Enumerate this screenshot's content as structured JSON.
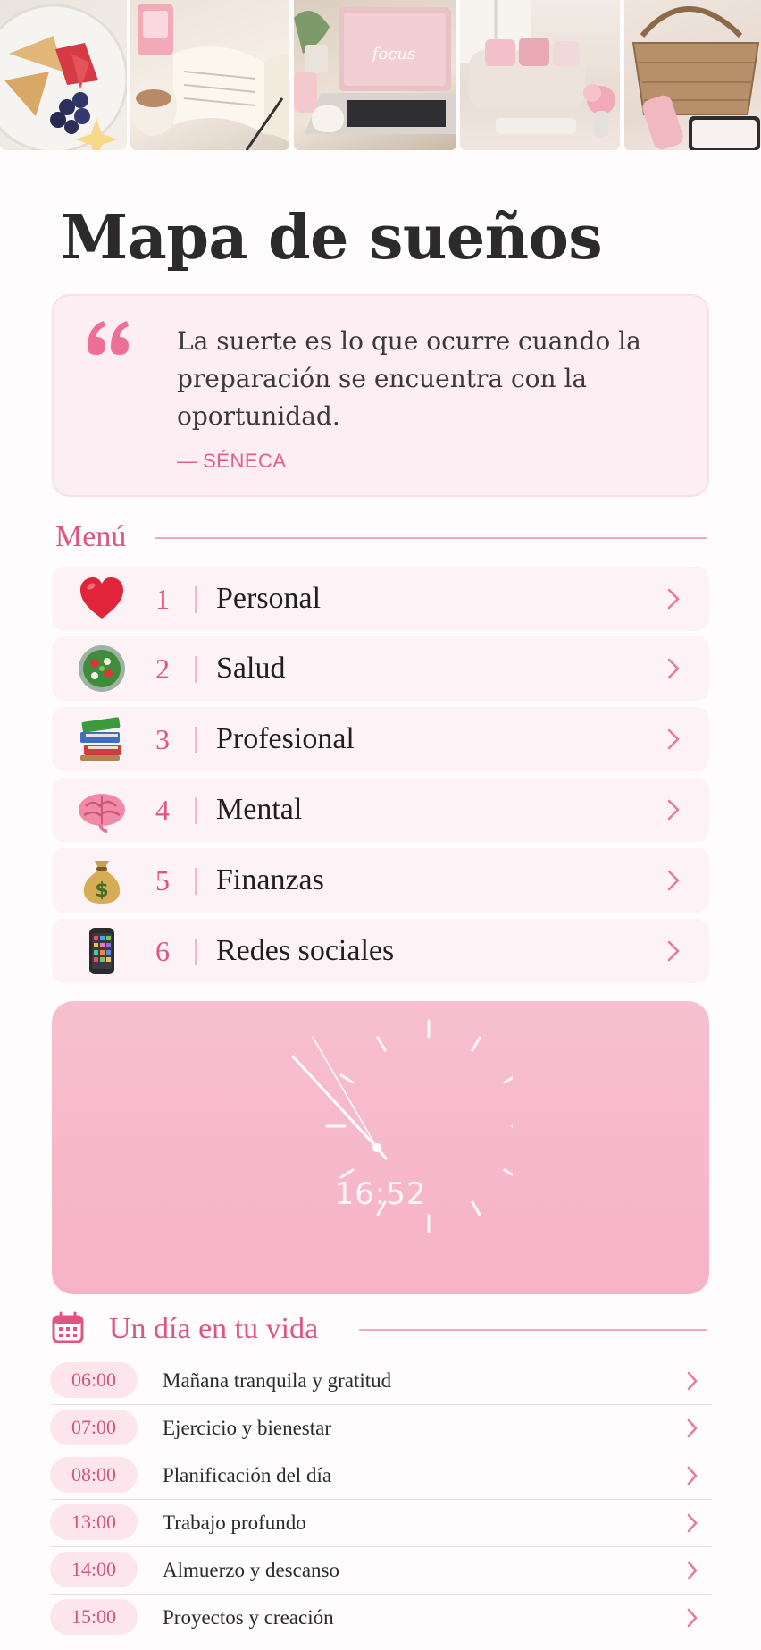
{
  "header": {
    "title": "Mapa de sueños"
  },
  "quote": {
    "text": "La suerte es lo que ocurre cuando la preparación se encuentra con la oportunidad.",
    "author": "— SÉNECA"
  },
  "menu": {
    "title": "Menú",
    "items": [
      {
        "num": "1",
        "label": "Personal",
        "icon": "heart-icon"
      },
      {
        "num": "2",
        "label": "Salud",
        "icon": "salad-icon"
      },
      {
        "num": "3",
        "label": "Profesional",
        "icon": "books-icon"
      },
      {
        "num": "4",
        "label": "Mental",
        "icon": "brain-icon"
      },
      {
        "num": "5",
        "label": "Finanzas",
        "icon": "money-bag-icon"
      },
      {
        "num": "6",
        "label": "Redes sociales",
        "icon": "mobile-phone-icon"
      }
    ]
  },
  "clock": {
    "time": "16:52"
  },
  "day": {
    "title": "Un día en tu vida",
    "icon": "calendar-icon",
    "items": [
      {
        "time": "06:00",
        "label": "Mañana tranquila y gratitud"
      },
      {
        "time": "07:00",
        "label": "Ejercicio y bienestar"
      },
      {
        "time": "08:00",
        "label": "Planificación del día"
      },
      {
        "time": "13:00",
        "label": "Trabajo profundo"
      },
      {
        "time": "14:00",
        "label": "Almuerzo y descanso"
      },
      {
        "time": "15:00",
        "label": "Proyectos y creación"
      }
    ]
  },
  "photos": [
    {
      "icon": "food-plate-photo",
      "text": ""
    },
    {
      "icon": "book-coffee-photo",
      "text": ""
    },
    {
      "icon": "laptop-photo",
      "text": "focus"
    },
    {
      "icon": "living-room-photo",
      "text": ""
    },
    {
      "icon": "basket-photo",
      "text": ""
    }
  ],
  "colors": {
    "accent": "#e0557f",
    "card": "#fdf3f6",
    "clock": "#f6b3c6"
  }
}
